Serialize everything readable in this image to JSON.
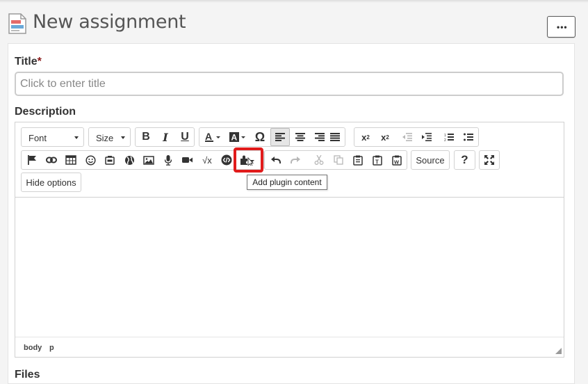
{
  "page": {
    "title": "New assignment",
    "more_label": "•••"
  },
  "form": {
    "title_label": "Title",
    "required_mark": "*",
    "title_placeholder": "Click to enter title",
    "description_label": "Description",
    "files_label": "Files"
  },
  "editor": {
    "font_combo": "Font",
    "size_combo": "Size",
    "format_buttons": [
      {
        "name": "bold-button",
        "label": "B"
      },
      {
        "name": "italic-button",
        "label": "I"
      },
      {
        "name": "underline-button",
        "label": "U"
      }
    ],
    "source_label": "Source",
    "help_label": "?",
    "hide_options_label": "Hide options",
    "tooltip": "Add plugin content",
    "status_path": [
      "body",
      "p"
    ]
  },
  "colors": {
    "highlight": "#e11b1b",
    "active_button": "#e6e6e6",
    "required": "#8b1a1a"
  }
}
